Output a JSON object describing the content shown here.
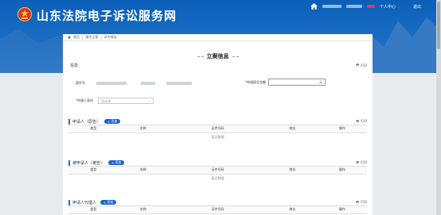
{
  "site": {
    "title": "山东法院电子诉讼服务网"
  },
  "topnav": {
    "personal_center": "个人中心",
    "logout": "退出"
  },
  "breadcrumb": [
    "首页",
    "指令立案",
    "诉中保全"
  ],
  "page_title": "立案信息",
  "print_label": "打印",
  "add_label": "添加",
  "sections": {
    "case_info": {
      "title": "信息",
      "case_no_label": "案件号",
      "amount_label": "*申请保全金额",
      "amount_value": "",
      "amount_unit": "元",
      "applicant_identity_label": "*申请人身份",
      "applicant_identity_placeholder": "请选择"
    },
    "applicant": {
      "title": "申请人（原告）",
      "columns": [
        "类型",
        "名称",
        "证件号码",
        "地址",
        "操作"
      ],
      "empty": "暂无数据"
    },
    "respondent": {
      "title": "被申请人（被告）",
      "columns": [
        "类型",
        "名称",
        "证件号码",
        "地址",
        "操作"
      ],
      "empty": "暂无数据"
    },
    "agent": {
      "title": "申请人代理人",
      "columns": [
        "类型",
        "名称",
        "证件号码",
        "地址",
        "操作"
      ]
    }
  }
}
